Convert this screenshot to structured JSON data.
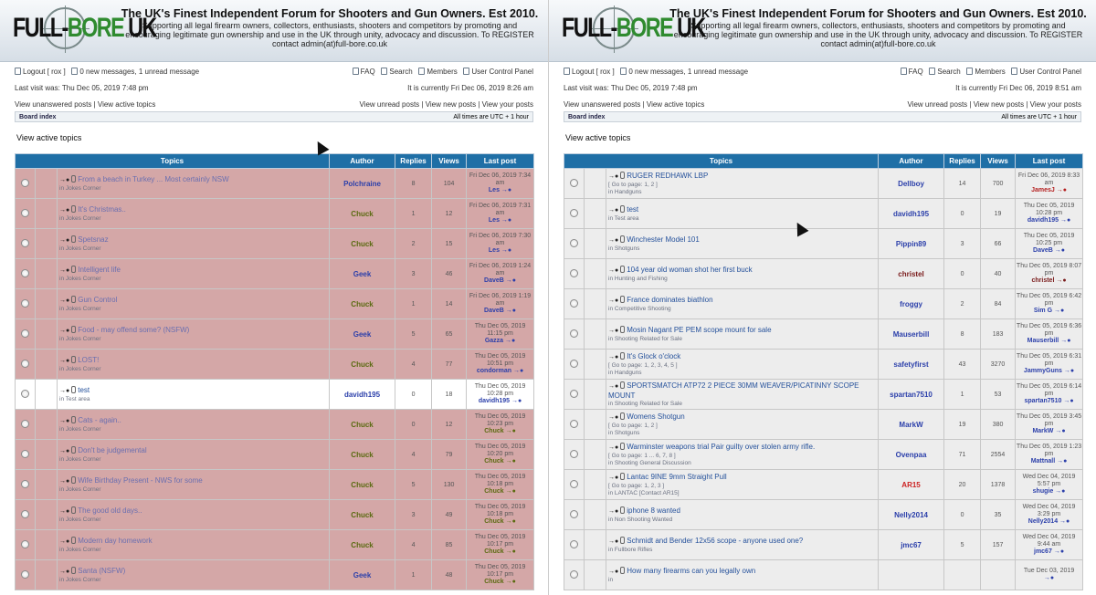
{
  "site": {
    "logo_a": "FULL-",
    "logo_b": "BORE",
    "logo_c": " UK",
    "headline": "The UK's Finest Independent Forum for Shooters and Gun Owners. Est 2010.",
    "tagline": "Supporting all legal firearm owners, collectors, enthusiasts, shooters and competitors by promoting and encouraging legitimate gun ownership and use in the UK through unity, advocacy and discussion. To REGISTER contact admin(at)full-bore.co.uk"
  },
  "nav": {
    "logout": "Logout [ rox ]",
    "messages_a": "0 new messages, 1 unread message",
    "faq": "FAQ",
    "search": "Search",
    "members": "Members",
    "ucp": "User Control Panel",
    "last_visit": "Last visit was: Thu Dec 05, 2019 7:48 pm",
    "unanswered": "View unanswered posts",
    "active": "View active topics",
    "unread": "View unread posts",
    "new_posts": "View new posts",
    "your_posts": "View your posts",
    "board_index": "Board index",
    "tz": "All times are UTC + 1 hour",
    "page_title": "View active topics"
  },
  "columns": {
    "topics": "Topics",
    "author": "Author",
    "replies": "Replies",
    "views": "Views",
    "last_post": "Last post"
  },
  "panes": [
    {
      "now": "It is currently Fri Dec 06, 2019 8:26 am",
      "rows": [
        {
          "style": "pink",
          "title": "From a beach in Turkey ... Most certainly NSW",
          "forum": "in Jokes Corner",
          "pages": "",
          "author": "Polchraine",
          "ac": "#2b3faa",
          "replies": "8",
          "views": "104",
          "date": "Fri Dec 06, 2019 7:34 am",
          "by": "Les",
          "bc": "#2b3faa"
        },
        {
          "style": "pink",
          "title": "It's Christmas..",
          "forum": "in Jokes Corner",
          "pages": "",
          "author": "Chuck",
          "ac": "#5a6a10",
          "replies": "1",
          "views": "12",
          "date": "Fri Dec 06, 2019 7:31 am",
          "by": "Les",
          "bc": "#2b3faa"
        },
        {
          "style": "pink",
          "title": "Spetsnaz",
          "forum": "in Jokes Corner",
          "pages": "",
          "author": "Chuck",
          "ac": "#5a6a10",
          "replies": "2",
          "views": "15",
          "date": "Fri Dec 06, 2019 7:30 am",
          "by": "Les",
          "bc": "#2b3faa"
        },
        {
          "style": "pink",
          "title": "Intelligent life",
          "forum": "in Jokes Corner",
          "pages": "",
          "author": "Geek",
          "ac": "#2b3faa",
          "replies": "3",
          "views": "46",
          "date": "Fri Dec 06, 2019 1:24 am",
          "by": "DaveB",
          "bc": "#2b3faa"
        },
        {
          "style": "pink",
          "title": "Gun Control",
          "forum": "in Jokes Corner",
          "pages": "",
          "author": "Chuck",
          "ac": "#5a6a10",
          "replies": "1",
          "views": "14",
          "date": "Fri Dec 06, 2019 1:19 am",
          "by": "DaveB",
          "bc": "#2b3faa"
        },
        {
          "style": "pink",
          "title": "Food - may offend some? (NSFW)",
          "forum": "in Jokes Corner",
          "pages": "",
          "author": "Geek",
          "ac": "#2b3faa",
          "replies": "5",
          "views": "65",
          "date": "Thu Dec 05, 2019 11:15 pm",
          "by": "Gazza",
          "bc": "#2b3faa"
        },
        {
          "style": "pink",
          "title": "LOST!",
          "forum": "in Jokes Corner",
          "pages": "",
          "author": "Chuck",
          "ac": "#5a6a10",
          "replies": "4",
          "views": "77",
          "date": "Thu Dec 05, 2019 10:51 pm",
          "by": "condorman",
          "bc": "#2b3faa"
        },
        {
          "style": "white",
          "title": "test",
          "forum": "in Test area",
          "pages": "",
          "author": "davidh195",
          "ac": "#2b3faa",
          "replies": "0",
          "views": "18",
          "date": "Thu Dec 05, 2019 10:28 pm",
          "by": "davidh195",
          "bc": "#2b3faa"
        },
        {
          "style": "pink",
          "title": "Cats - again..",
          "forum": "in Jokes Corner",
          "pages": "",
          "author": "Chuck",
          "ac": "#5a6a10",
          "replies": "0",
          "views": "12",
          "date": "Thu Dec 05, 2019 10:23 pm",
          "by": "Chuck",
          "bc": "#5a6a10"
        },
        {
          "style": "pink",
          "title": "Don't be judgemental",
          "forum": "in Jokes Corner",
          "pages": "",
          "author": "Chuck",
          "ac": "#5a6a10",
          "replies": "4",
          "views": "79",
          "date": "Thu Dec 05, 2019 10:20 pm",
          "by": "Chuck",
          "bc": "#5a6a10"
        },
        {
          "style": "pink",
          "title": "Wife Birthday Present - NWS for some",
          "forum": "in Jokes Corner",
          "pages": "",
          "author": "Chuck",
          "ac": "#5a6a10",
          "replies": "5",
          "views": "130",
          "date": "Thu Dec 05, 2019 10:18 pm",
          "by": "Chuck",
          "bc": "#5a6a10"
        },
        {
          "style": "pink",
          "title": "The good old days..",
          "forum": "in Jokes Corner",
          "pages": "",
          "author": "Chuck",
          "ac": "#5a6a10",
          "replies": "3",
          "views": "49",
          "date": "Thu Dec 05, 2019 10:18 pm",
          "by": "Chuck",
          "bc": "#5a6a10"
        },
        {
          "style": "pink",
          "title": "Modern day homework",
          "forum": "in Jokes Corner",
          "pages": "",
          "author": "Chuck",
          "ac": "#5a6a10",
          "replies": "4",
          "views": "85",
          "date": "Thu Dec 05, 2019 10:17 pm",
          "by": "Chuck",
          "bc": "#5a6a10"
        },
        {
          "style": "pink",
          "title": "Santa (NSFW)",
          "forum": "in Jokes Corner",
          "pages": "",
          "author": "Geek",
          "ac": "#2b3faa",
          "replies": "1",
          "views": "48",
          "date": "Thu Dec 05, 2019 10:17 pm",
          "by": "Chuck",
          "bc": "#5a6a10"
        }
      ]
    },
    {
      "now": "It is currently Fri Dec 06, 2019 8:51 am",
      "rows": [
        {
          "style": "grey",
          "title": "RUGER REDHAWK LBP",
          "forum": "in Handguns",
          "pages": "[ Go to page: 1, 2 ]",
          "author": "Dellboy",
          "ac": "#2b3faa",
          "replies": "14",
          "views": "700",
          "date": "Fri Dec 06, 2019 8:33 am",
          "by": "JamesJ",
          "bc": "#b52020"
        },
        {
          "style": "grey",
          "title": "test",
          "forum": "in Test area",
          "pages": "",
          "author": "davidh195",
          "ac": "#2b3faa",
          "replies": "0",
          "views": "19",
          "date": "Thu Dec 05, 2019 10:28 pm",
          "by": "davidh195",
          "bc": "#2b3faa"
        },
        {
          "style": "grey",
          "title": "Winchester Model 101",
          "forum": "in Shotguns",
          "pages": "",
          "author": "Pippin89",
          "ac": "#2b3faa",
          "replies": "3",
          "views": "66",
          "date": "Thu Dec 05, 2019 10:25 pm",
          "by": "DaveB",
          "bc": "#2b3faa"
        },
        {
          "style": "grey",
          "title": "104 year old woman shot her first buck",
          "forum": "in Hunting and Fishing",
          "pages": "",
          "author": "christel",
          "ac": "#7a1b1b",
          "replies": "0",
          "views": "40",
          "date": "Thu Dec 05, 2019 8:07 pm",
          "by": "christel",
          "bc": "#7a1b1b"
        },
        {
          "style": "grey",
          "title": "France dominates biathlon",
          "forum": "in Competitive Shooting",
          "pages": "",
          "author": "froggy",
          "ac": "#2b3faa",
          "replies": "2",
          "views": "84",
          "date": "Thu Dec 05, 2019 6:42 pm",
          "by": "Sim G",
          "bc": "#2b3faa"
        },
        {
          "style": "grey",
          "title": "Mosin Nagant PE PEM scope mount for sale",
          "forum": "in Shooting Related for Sale",
          "pages": "",
          "author": "Mauserbill",
          "ac": "#2b3faa",
          "replies": "8",
          "views": "183",
          "date": "Thu Dec 05, 2019 6:36 pm",
          "by": "Mauserbill",
          "bc": "#2b3faa"
        },
        {
          "style": "grey",
          "title": "It's Glock o'clock",
          "forum": "in Handguns",
          "pages": "[ Go to page: 1, 2, 3, 4, 5 ]",
          "author": "safetyfirst",
          "ac": "#2b3faa",
          "replies": "43",
          "views": "3270",
          "date": "Thu Dec 05, 2019 6:31 pm",
          "by": "JammyGuns",
          "bc": "#2b3faa"
        },
        {
          "style": "grey",
          "title": "SPORTSMATCH ATP72 2 PIECE 30MM WEAVER/PICATINNY SCOPE MOUNT",
          "forum": "in Shooting Related for Sale",
          "pages": "",
          "author": "spartan7510",
          "ac": "#2b3faa",
          "replies": "1",
          "views": "53",
          "date": "Thu Dec 05, 2019 6:14 pm",
          "by": "spartan7510",
          "bc": "#2b3faa"
        },
        {
          "style": "grey",
          "title": "Womens Shotgun",
          "forum": "in Shotguns",
          "pages": "[ Go to page: 1, 2 ]",
          "author": "MarkW",
          "ac": "#2b3faa",
          "replies": "19",
          "views": "380",
          "date": "Thu Dec 05, 2019 3:45 pm",
          "by": "MarkW",
          "bc": "#2b3faa"
        },
        {
          "style": "grey",
          "title": "Warminster weapons trial Pair guilty over stolen army rifle.",
          "forum": "in Shooting General Discussion",
          "pages": "[ Go to page: 1 ... 6, 7, 8 ]",
          "author": "Ovenpaa",
          "ac": "#2b3faa",
          "replies": "71",
          "views": "2554",
          "date": "Thu Dec 05, 2019 1:23 pm",
          "by": "Mattnall",
          "bc": "#2b3faa"
        },
        {
          "style": "grey",
          "title": "Lantac 9INE 9mm Straight Pull",
          "forum": "in LANTAC [Contact AR15]",
          "pages": "[ Go to page: 1, 2, 3 ]",
          "author": "AR15",
          "ac": "#c22",
          "replies": "20",
          "views": "1378",
          "date": "Wed Dec 04, 2019 5:57 pm",
          "by": "shugie",
          "bc": "#2b3faa"
        },
        {
          "style": "grey",
          "title": "iphone 8 wanted",
          "forum": "in Non Shooting Wanted",
          "pages": "",
          "author": "Nelly2014",
          "ac": "#2b3faa",
          "replies": "0",
          "views": "35",
          "date": "Wed Dec 04, 2019 3:29 pm",
          "by": "Nelly2014",
          "bc": "#2b3faa"
        },
        {
          "style": "grey",
          "title": "Schmidt and Bender 12x56 scope - anyone used one?",
          "forum": "in Fullbore Rifles",
          "pages": "",
          "author": "jmc67",
          "ac": "#2b3faa",
          "replies": "5",
          "views": "157",
          "date": "Wed Dec 04, 2019 9:44 am",
          "by": "jmc67",
          "bc": "#2b3faa"
        },
        {
          "style": "grey",
          "title": "How many firearms can you legally own",
          "forum": "in",
          "pages": "",
          "author": "",
          "ac": "#2b3faa",
          "replies": "",
          "views": "",
          "date": "Tue Dec 03, 2019",
          "by": "",
          "bc": "#2b3faa"
        }
      ]
    }
  ]
}
